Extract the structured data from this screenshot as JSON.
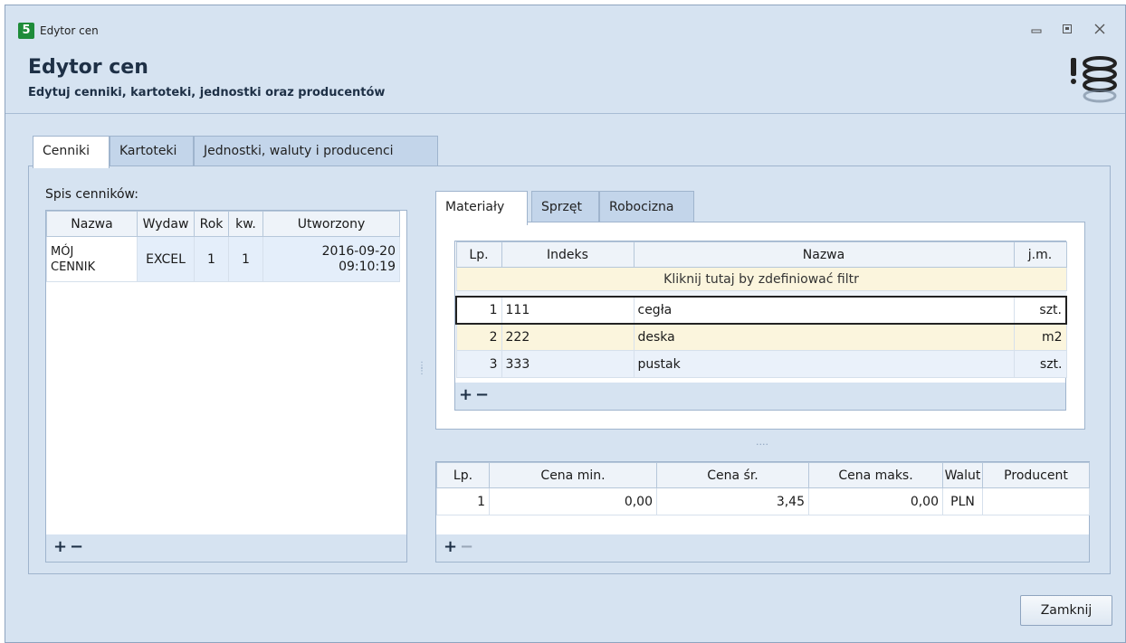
{
  "window": {
    "title": "Edytor cen",
    "icon_glyph": "5",
    "controls": [
      "minimize-icon",
      "maximize-icon",
      "close-icon"
    ]
  },
  "header": {
    "title": "Edytor cen",
    "subtitle": "Edytuj cenniki, kartoteki, jednostki oraz producentów"
  },
  "main_tabs": [
    {
      "label": "Cenniki",
      "active": true
    },
    {
      "label": "Kartoteki",
      "active": false
    },
    {
      "label": "Jednostki, waluty i producenci",
      "active": false
    }
  ],
  "pricelists": {
    "label": "Spis cenników:",
    "columns": [
      "Nazwa",
      "Wydaw",
      "Rok",
      "kw.",
      "Utworzony"
    ],
    "rows": [
      {
        "nazwa_line1": "MÓJ",
        "nazwa_line2": "CENNIK",
        "wydaw": "EXCEL",
        "rok": "1",
        "kw": "1",
        "utw_line1": "2016-09-20",
        "utw_line2": "09:10:19"
      }
    ],
    "add_label": "+",
    "remove_label": "−"
  },
  "sub_tabs": [
    {
      "label": "Materiały",
      "active": true
    },
    {
      "label": "Sprzęt",
      "active": false
    },
    {
      "label": "Robocizna",
      "active": false
    }
  ],
  "materials": {
    "columns": [
      "Lp.",
      "Indeks",
      "Nazwa",
      "j.m."
    ],
    "filter_text": "Kliknij tutaj by zdefiniować filtr",
    "rows": [
      {
        "lp": "1",
        "indeks": "111",
        "nazwa": "cegła",
        "jm": "szt."
      },
      {
        "lp": "2",
        "indeks": "222",
        "nazwa": "deska",
        "jm": "m2"
      },
      {
        "lp": "3",
        "indeks": "333",
        "nazwa": "pustak",
        "jm": "szt."
      }
    ],
    "add_label": "+",
    "remove_label": "−"
  },
  "prices": {
    "columns": [
      "Lp.",
      "Cena min.",
      "Cena śr.",
      "Cena maks.",
      "Walut",
      "Producent"
    ],
    "rows": [
      {
        "lp": "1",
        "min": "0,00",
        "sr": "3,45",
        "maks": "0,00",
        "waluta": "PLN",
        "producent": ""
      }
    ],
    "add_label": "+",
    "remove_label": "−"
  },
  "footer": {
    "close_label": "Zamknij"
  },
  "colors": {
    "window_bg": "#d6e3f1",
    "accent_dark": "#1e3046",
    "filter_bg": "#fbf5dd",
    "app_icon": "#1e8c3a"
  }
}
